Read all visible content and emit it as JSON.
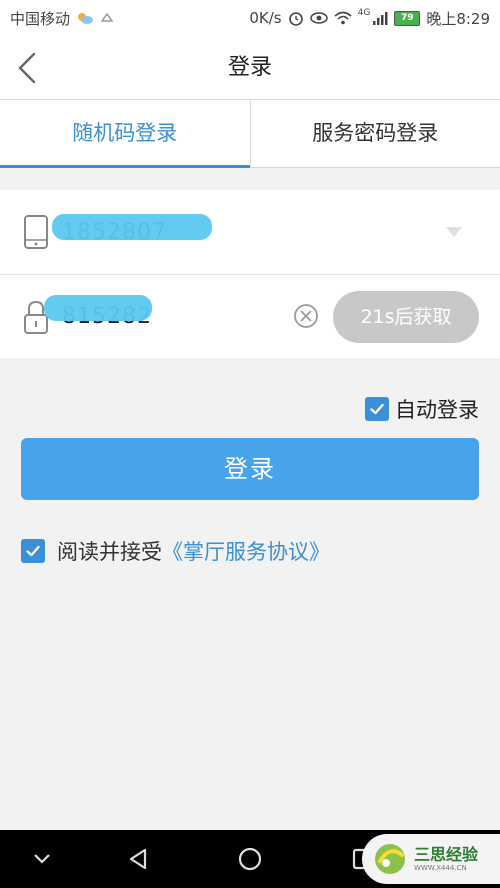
{
  "status_bar": {
    "carrier": "中国移动",
    "speed": "0K/s",
    "network": "4G",
    "battery": "79",
    "time": "晚上8:29"
  },
  "header": {
    "title": "登录",
    "back_icon": "chevron-left-icon"
  },
  "tabs": [
    {
      "label": "随机码登录",
      "active": true
    },
    {
      "label": "服务密码登录",
      "active": false
    }
  ],
  "form": {
    "phone_value": "1852807",
    "code_value": "815282",
    "get_code_label": "21s后获取"
  },
  "auto_login": {
    "label": "自动登录",
    "checked": true
  },
  "login_button": {
    "label": "登录"
  },
  "agreement": {
    "prefix": "阅读并接受",
    "link": "《掌厅服务协议》",
    "checked": true
  },
  "watermark": {
    "name": "三思经验",
    "url": "WWW.X444.CN"
  },
  "colors": {
    "accent": "#3a8fd6",
    "button": "#47a4ea",
    "disabled": "#c8c8c8"
  }
}
